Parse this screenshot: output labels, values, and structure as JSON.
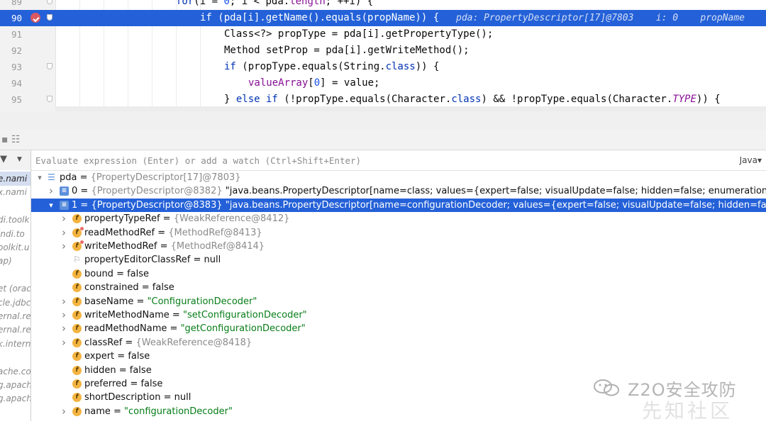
{
  "editor": {
    "lines": [
      {
        "num": "89",
        "parts": [
          [
            "kw",
            "for"
          ],
          [
            "",
            "(i = "
          ],
          [
            "num",
            "0"
          ],
          [
            "",
            "; i < pda."
          ],
          [
            "fld",
            "length"
          ],
          [
            "",
            "; ++i) {"
          ]
        ]
      },
      {
        "num": "90",
        "parts": [
          [
            "kw",
            "if"
          ],
          [
            "",
            " (pda[i].getName().equals(propName)) {"
          ]
        ]
      },
      {
        "num": "91",
        "parts": [
          [
            "",
            "Class<?> propType = pda[i].getPropertyType();"
          ]
        ]
      },
      {
        "num": "92",
        "parts": [
          [
            "",
            "Method setProp = pda[i].getWriteMethod();"
          ]
        ]
      },
      {
        "num": "93",
        "parts": [
          [
            "kw",
            "if"
          ],
          [
            "",
            " (propType.equals(String."
          ],
          [
            "kw",
            "class"
          ],
          [
            "",
            "))"
          ],
          [
            "",
            " {"
          ]
        ]
      },
      {
        "num": "94",
        "parts": [
          [
            "fld",
            "valueArray"
          ],
          [
            "",
            "["
          ],
          [
            "num",
            "0"
          ],
          [
            "",
            "] = value;"
          ]
        ]
      },
      {
        "num": "95",
        "parts": [
          [
            "",
            "} "
          ],
          [
            "kw",
            "else if"
          ],
          [
            "",
            " (!propType.equals(Character."
          ],
          [
            "kw",
            "class"
          ],
          [
            "",
            ") && !propType.equals(Character."
          ],
          [
            "cst",
            "TYPE"
          ],
          [
            "",
            ")) {"
          ]
        ]
      }
    ],
    "inline_hint": "pda: PropertyDescriptor[17]@7803    i: 0    propName"
  },
  "evaluate": {
    "placeholder": "Evaluate expression (Enter) or add a watch (Ctrl+Shift+Enter)",
    "language": "Java▾"
  },
  "frames": [
    "e.nami",
    "x.nami",
    "",
    "di.toolk",
    "jndi.to",
    "oolkit.u",
    "ap)",
    "",
    "et (orac",
    "cle.jdbc",
    "ernal.re",
    "ernal.re",
    "k.intern",
    "",
    "ache.co",
    "g.apach",
    "g.apach"
  ],
  "variables": [
    {
      "depth": 0,
      "arrow": "▾",
      "icon": "list",
      "name": "pda",
      "ref": "{PropertyDescriptor[17]@7803}",
      "value": ""
    },
    {
      "depth": 1,
      "arrow": "›",
      "icon": "arr",
      "name": "0",
      "ref": "{PropertyDescriptor@8382}",
      "value": "\"java.beans.PropertyDescriptor[name=class; values={expert=false; visualUpdate=false; hidden=false; enumerationValues=[Ljava.lang.Object;@"
    },
    {
      "depth": 1,
      "arrow": "▾",
      "icon": "arr",
      "name": "1",
      "ref": "{PropertyDescriptor@8383}",
      "value": "\"java.beans.PropertyDescriptor[name=configurationDecoder; values={expert=false; visualUpdate=false; hidden=false; enumerationValues=[L",
      "selected": true
    },
    {
      "depth": 2,
      "arrow": "›",
      "icon": "f",
      "name": "propertyTypeRef",
      "ref": "{WeakReference@8412}",
      "value": ""
    },
    {
      "depth": 2,
      "arrow": "›",
      "icon": "ffin",
      "name": "readMethodRef",
      "ref": "{MethodRef@8413}",
      "value": ""
    },
    {
      "depth": 2,
      "arrow": "›",
      "icon": "ffin",
      "name": "writeMethodRef",
      "ref": "{MethodRef@8414}",
      "value": ""
    },
    {
      "depth": 2,
      "arrow": "",
      "icon": "flag",
      "name": "propertyEditorClassRef",
      "ref": "",
      "value": "null"
    },
    {
      "depth": 2,
      "arrow": "",
      "icon": "f",
      "name": "bound",
      "ref": "",
      "value": "false"
    },
    {
      "depth": 2,
      "arrow": "",
      "icon": "f",
      "name": "constrained",
      "ref": "",
      "value": "false"
    },
    {
      "depth": 2,
      "arrow": "›",
      "icon": "f",
      "name": "baseName",
      "ref": "",
      "value": "\"ConfigurationDecoder\"",
      "str": true
    },
    {
      "depth": 2,
      "arrow": "›",
      "icon": "f",
      "name": "writeMethodName",
      "ref": "",
      "value": "\"setConfigurationDecoder\"",
      "str": true
    },
    {
      "depth": 2,
      "arrow": "›",
      "icon": "f",
      "name": "readMethodName",
      "ref": "",
      "value": "\"getConfigurationDecoder\"",
      "str": true
    },
    {
      "depth": 2,
      "arrow": "›",
      "icon": "f",
      "name": "classRef",
      "ref": "{WeakReference@8418}",
      "value": ""
    },
    {
      "depth": 2,
      "arrow": "",
      "icon": "f",
      "name": "expert",
      "ref": "",
      "value": "false"
    },
    {
      "depth": 2,
      "arrow": "",
      "icon": "f",
      "name": "hidden",
      "ref": "",
      "value": "false"
    },
    {
      "depth": 2,
      "arrow": "",
      "icon": "f",
      "name": "preferred",
      "ref": "",
      "value": "false"
    },
    {
      "depth": 2,
      "arrow": "",
      "icon": "f",
      "name": "shortDescription",
      "ref": "",
      "value": "null"
    },
    {
      "depth": 2,
      "arrow": "›",
      "icon": "f",
      "name": "name",
      "ref": "",
      "value": "\"configurationDecoder\"",
      "str": true
    }
  ],
  "watermark": {
    "brand": "Z2O安全攻防",
    "sub": "先知社区"
  },
  "colors": {
    "selection": "#2461d8",
    "string": "#067d17",
    "keyword": "#0033b3"
  }
}
